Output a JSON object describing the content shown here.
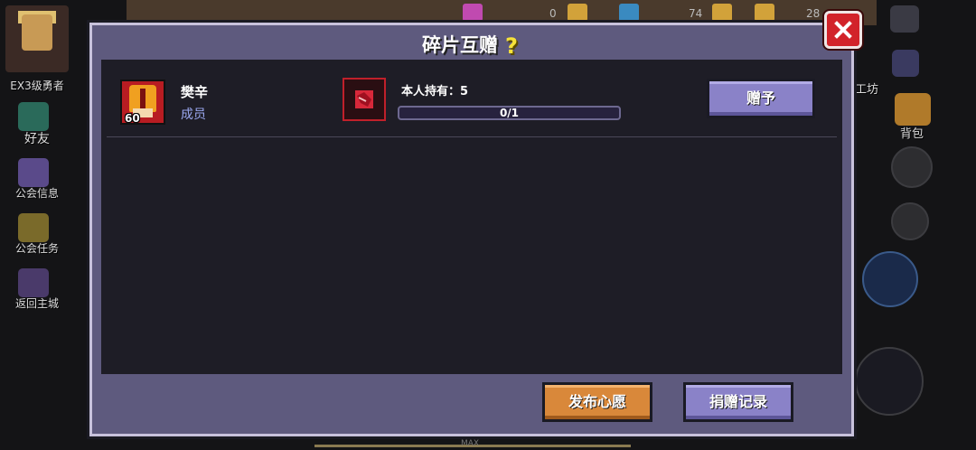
{
  "background": {
    "player_title": "EX3级勇者",
    "left_menu": [
      {
        "label": "好友",
        "icon": "friend-icon"
      },
      {
        "label": "公会信息",
        "icon": "guild-info-icon"
      },
      {
        "label": "公会任务",
        "icon": "guild-task-icon"
      },
      {
        "label": "返回主城",
        "icon": "return-city-icon"
      }
    ],
    "right_menu": {
      "workshop_label": "去工坊",
      "backpack_label": "背包"
    },
    "top_counts": [
      "0",
      "74",
      "28"
    ],
    "bottom_max_label": "MAX"
  },
  "modal": {
    "title": "碎片互赠",
    "help_glyph": "?",
    "close_glyph": "close-icon",
    "members": [
      {
        "level": "60",
        "name": "樊辛",
        "role": "成员",
        "owned_label": "本人持有：5",
        "progress_text": "0/1",
        "progress_fraction": 0,
        "give_label": "赠予"
      }
    ],
    "footer": {
      "wish_label": "发布心愿",
      "record_label": "捐赠记录"
    }
  },
  "colors": {
    "modal_frame": "#5e5a7e",
    "modal_body": "#1e1d26",
    "close_red": "#d2232a",
    "purple_button": "#8a82c8",
    "orange_button": "#d9883a",
    "role_text": "#9aa8f0",
    "help_yellow": "#f6e23a"
  }
}
